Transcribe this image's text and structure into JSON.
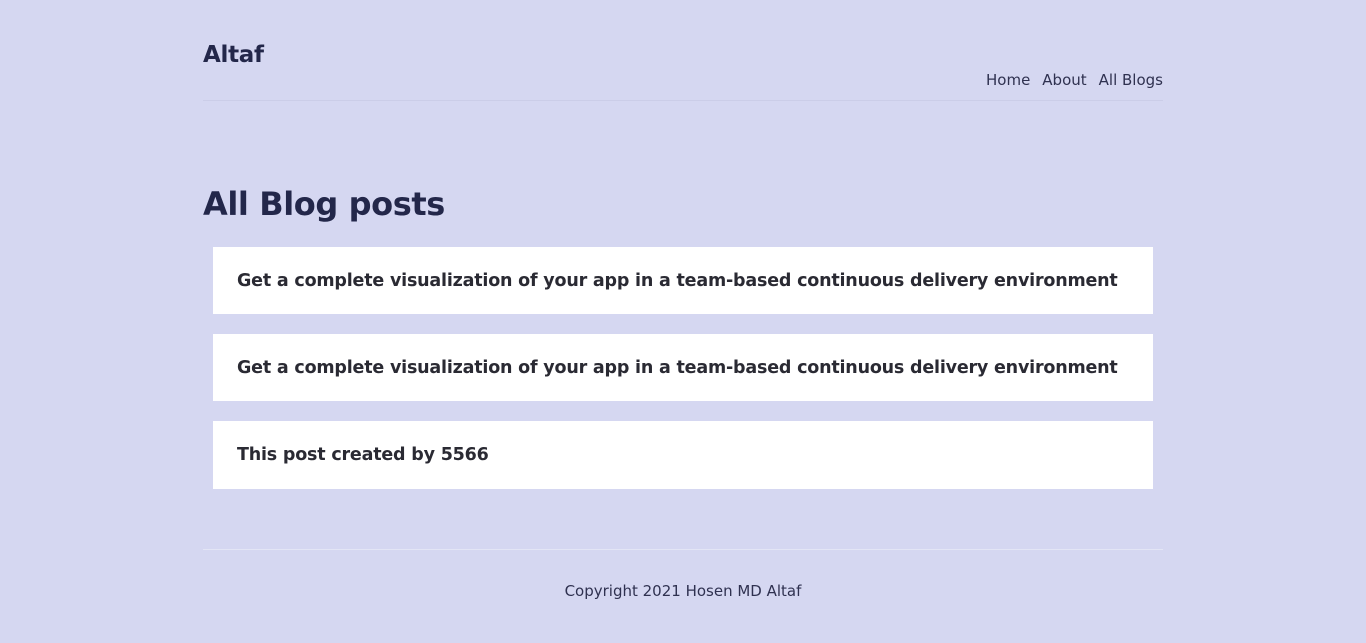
{
  "header": {
    "brand": "Altaf",
    "nav": [
      {
        "label": "Home"
      },
      {
        "label": "About"
      },
      {
        "label": "All Blogs"
      }
    ]
  },
  "main": {
    "heading": "All Blog posts",
    "posts": [
      {
        "title": "Get a complete visualization of your app in a team-based continuous delivery environment"
      },
      {
        "title": "Get a complete visualization of your app in a team-based continuous delivery environment"
      },
      {
        "title": "This post created by 5566"
      }
    ]
  },
  "footer": {
    "copyright": "Copyright 2021 Hosen MD Altaf"
  }
}
